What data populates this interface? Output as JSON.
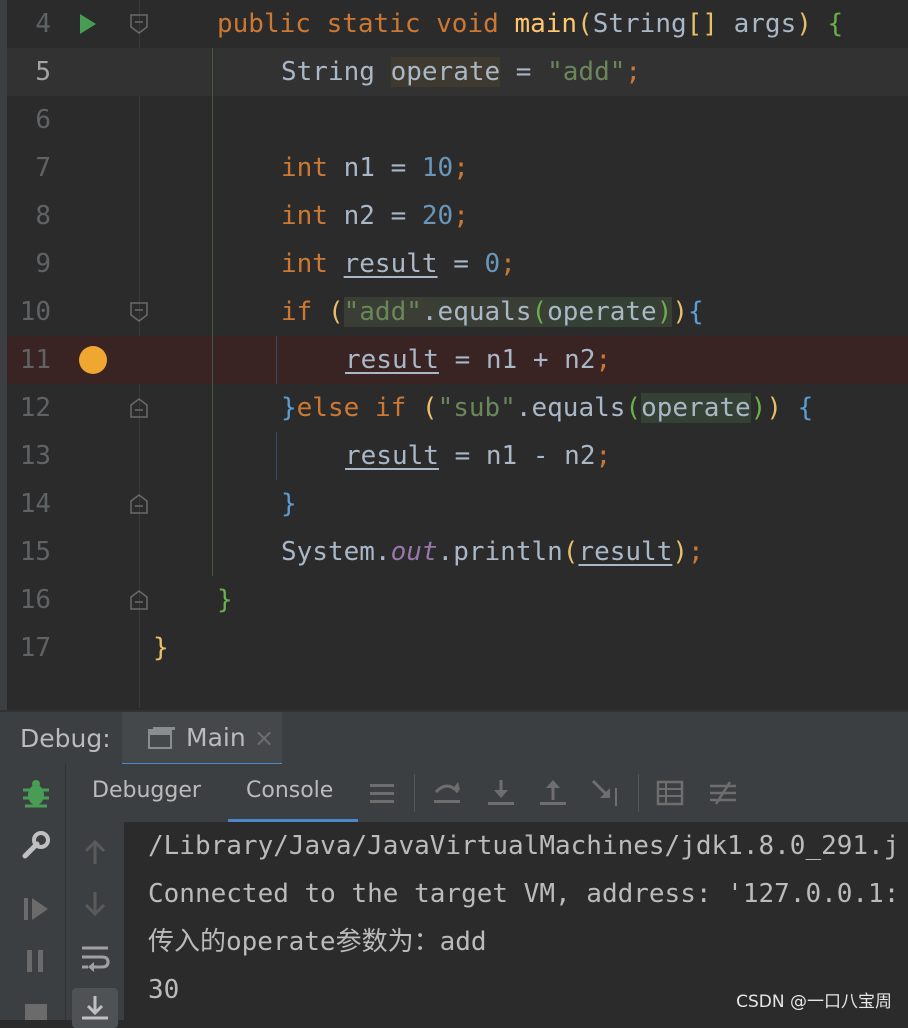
{
  "editor": {
    "current_line": 5,
    "breakpoint_line": 11,
    "lines": [
      {
        "n": "4"
      },
      {
        "n": "5"
      },
      {
        "n": "6"
      },
      {
        "n": "7"
      },
      {
        "n": "8"
      },
      {
        "n": "9"
      },
      {
        "n": "10"
      },
      {
        "n": "11"
      },
      {
        "n": "12"
      },
      {
        "n": "13"
      },
      {
        "n": "14"
      },
      {
        "n": "15"
      },
      {
        "n": "16"
      },
      {
        "n": "17"
      }
    ],
    "tokens": {
      "public": "public",
      "static": "static",
      "void": "void",
      "main": "main",
      "String": "String",
      "brackets": "[]",
      "args": "args",
      "brace_open": "{",
      "brace_close": "}",
      "operate": "operate",
      "eq": " = ",
      "add_str": "\"add\"",
      "sub_str": "\"sub\"",
      "semi": ";",
      "int": "int",
      "n1": "n1",
      "n2": "n2",
      "result": "result",
      "ten": "10",
      "twenty": "20",
      "zero": "0",
      "if": "if",
      "else": "else",
      "equals": ".equals",
      "plus": " + ",
      "minus": " - ",
      "System": "System",
      "out": "out",
      "println": ".println",
      "dot": ".",
      "lpar": "(",
      "rpar": ")"
    }
  },
  "debug": {
    "label": "Debug:",
    "session_tab": "Main",
    "close": "×",
    "subtabs": [
      "Debugger",
      "Console"
    ],
    "active_subtab": "Console"
  },
  "console": {
    "lines": [
      "/Library/Java/JavaVirtualMachines/jdk1.8.0_291.j",
      "Connected to the target VM, address: '127.0.0.1:",
      "传入的operate参数为：add",
      "30"
    ]
  },
  "watermark": "CSDN @一口八宝周",
  "colors": {
    "keyword": "#cc7832",
    "string": "#6a8759",
    "number": "#6897bb",
    "method": "#ffc66d",
    "field": "#9876aa",
    "text": "#a9b7c6",
    "breakpoint": "#f0a732",
    "run": "#499c54",
    "accent": "#4a88c7"
  }
}
